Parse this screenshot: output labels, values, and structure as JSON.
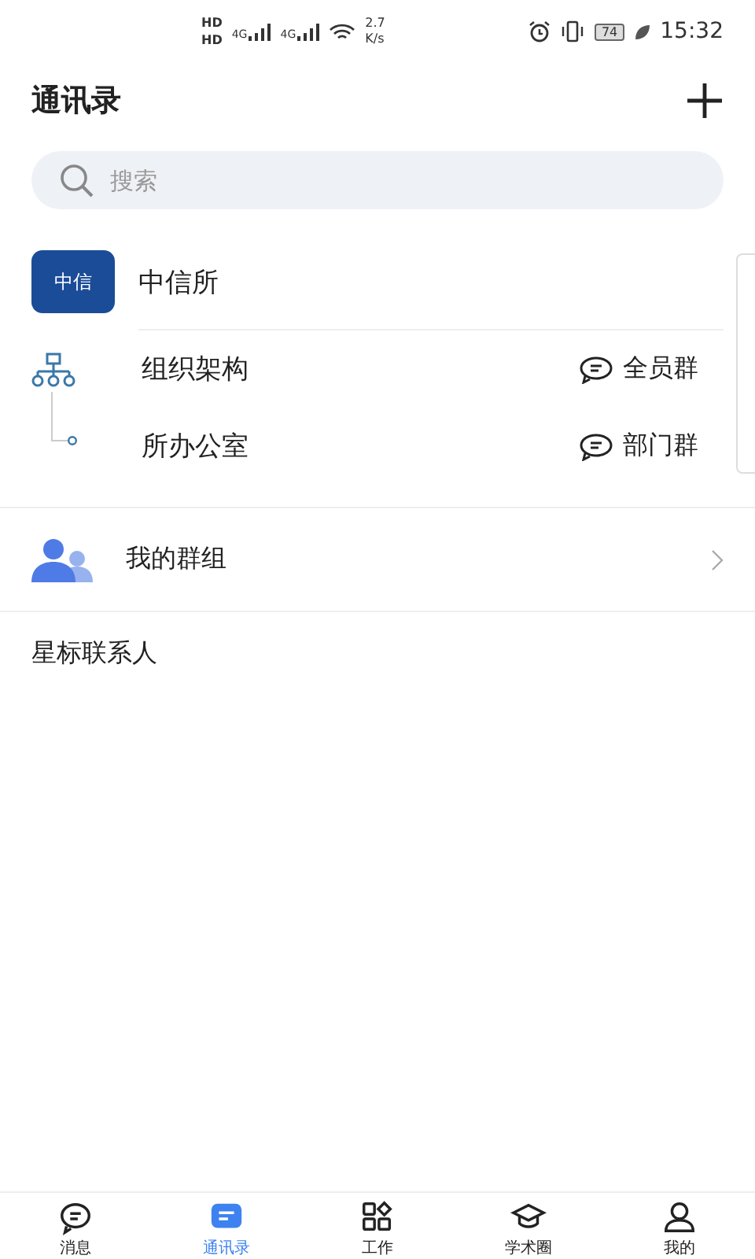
{
  "status_bar": {
    "hd_labels": [
      "HD",
      "HD"
    ],
    "signal_labels": [
      "4G",
      "4G"
    ],
    "speed_value": "2.7",
    "speed_unit": "K/s",
    "battery": "74",
    "time": "15:32"
  },
  "header": {
    "title": "通讯录"
  },
  "search": {
    "placeholder": "搜索"
  },
  "organization": {
    "logo_text": "中信",
    "name": "中信所",
    "rows": [
      {
        "label": "组织架构",
        "group_label": "全员群"
      },
      {
        "label": "所办公室",
        "group_label": "部门群"
      }
    ]
  },
  "my_groups": {
    "label": "我的群组"
  },
  "starred": {
    "label": "星标联系人"
  },
  "tabs": [
    {
      "label": "消息",
      "selected": false
    },
    {
      "label": "通讯录",
      "selected": true
    },
    {
      "label": "工作",
      "selected": false
    },
    {
      "label": "学术圈",
      "selected": false
    },
    {
      "label": "我的",
      "selected": false
    }
  ]
}
